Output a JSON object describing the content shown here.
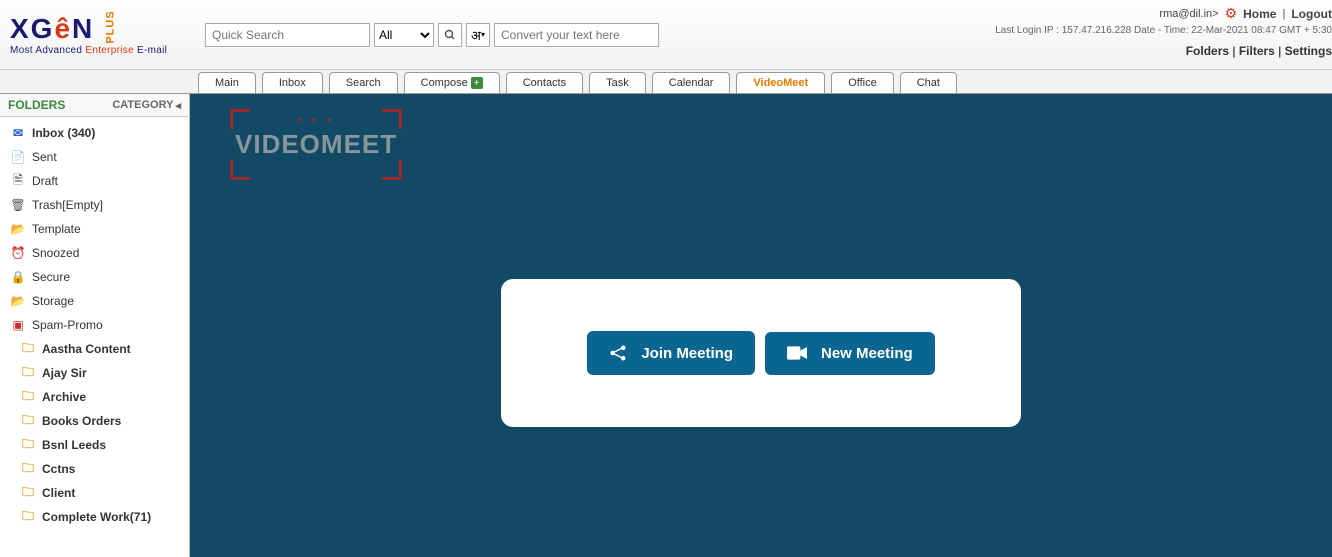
{
  "header": {
    "logo_tagline_pre": "Most Advanced ",
    "logo_tagline_mid": "Enterprise",
    "logo_tagline_post": " E-mail",
    "quick_search_placeholder": "Quick Search",
    "search_select_value": "All",
    "convert_placeholder": "Convert your text here",
    "user_email": "rma@dil.in>",
    "home_label": "Home",
    "logout_label": "Logout",
    "login_info": "Last Login IP : 157.47.216.228 Date - Time: 22-Mar-2021 08:47 GMT + 5:30",
    "right_links": {
      "folders": "Folders",
      "filters": "Filters",
      "settings": "Settings"
    }
  },
  "tabs": [
    {
      "label": "Main"
    },
    {
      "label": "Inbox"
    },
    {
      "label": "Search"
    },
    {
      "label": "Compose"
    },
    {
      "label": "Contacts"
    },
    {
      "label": "Task"
    },
    {
      "label": "Calendar"
    },
    {
      "label": "VideoMeet"
    },
    {
      "label": "Office"
    },
    {
      "label": "Chat"
    }
  ],
  "sidebar": {
    "folders_label": "FOLDERS",
    "category_label": "CATEGORY",
    "items": [
      {
        "label": "Inbox (340)"
      },
      {
        "label": "Sent"
      },
      {
        "label": "Draft"
      },
      {
        "label": "Trash[Empty]"
      },
      {
        "label": "Template"
      },
      {
        "label": "Snoozed"
      },
      {
        "label": "Secure"
      },
      {
        "label": "Storage"
      },
      {
        "label": "Spam-Promo"
      }
    ],
    "subfolders": [
      {
        "label": "Aastha Content"
      },
      {
        "label": "Ajay Sir"
      },
      {
        "label": "Archive"
      },
      {
        "label": "Books Orders"
      },
      {
        "label": "Bsnl Leeds"
      },
      {
        "label": "Cctns"
      },
      {
        "label": "Client"
      },
      {
        "label": "Complete Work(71)"
      }
    ]
  },
  "videomeet": {
    "logo_text": "VIDEOMEET",
    "join_label": "Join Meeting",
    "new_label": "New Meeting"
  }
}
